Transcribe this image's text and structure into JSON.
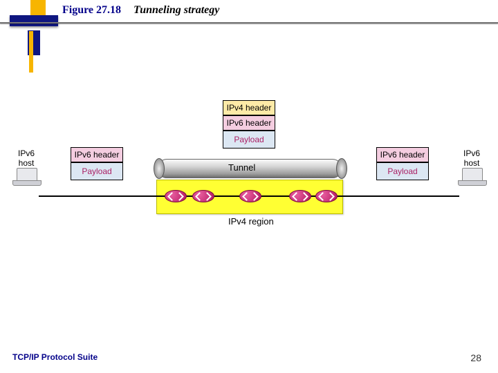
{
  "title": {
    "figure": "Figure 27.18",
    "caption": "Tunneling strategy"
  },
  "footer": {
    "left": "TCP/IP Protocol Suite",
    "page": "28"
  },
  "encap": {
    "ipv4": "IPv4 header",
    "ipv6": "IPv6 header",
    "payload": "Payload"
  },
  "left": {
    "ipv6": "IPv6 header",
    "payload": "Payload"
  },
  "right": {
    "ipv6": "IPv6 header",
    "payload": "Payload"
  },
  "tunnel": "Tunnel",
  "region": "IPv4 region",
  "hosts": {
    "left1": "IPv6",
    "left2": "host",
    "right1": "IPv6",
    "right2": "host"
  }
}
